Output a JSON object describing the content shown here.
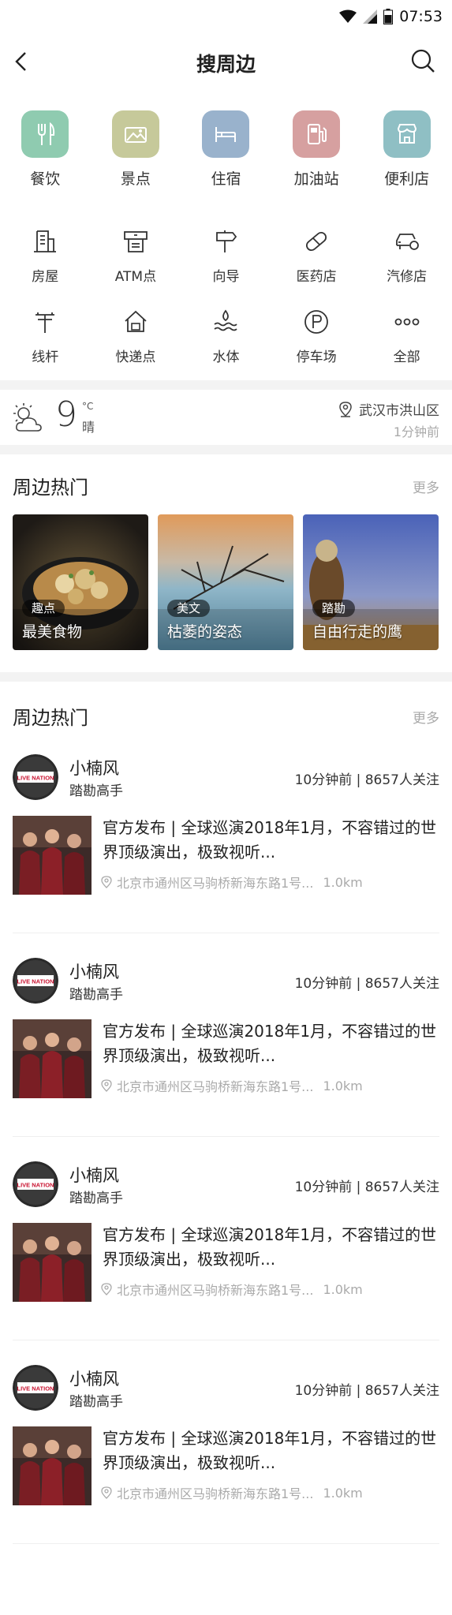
{
  "status": {
    "time": "07:53"
  },
  "nav": {
    "title": "搜周边"
  },
  "top_categories": [
    {
      "label": "餐饮",
      "icon": "utensils-icon",
      "color": "#8fcbb0"
    },
    {
      "label": "景点",
      "icon": "landscape-icon",
      "color": "#c6c99a"
    },
    {
      "label": "住宿",
      "icon": "bed-icon",
      "color": "#99b2cc"
    },
    {
      "label": "加油站",
      "icon": "fuel-pump-icon",
      "color": "#d6a0a0"
    },
    {
      "label": "便利店",
      "icon": "store-icon",
      "color": "#8fbfc4"
    }
  ],
  "grid_row1": [
    {
      "label": "房屋",
      "icon": "building-icon"
    },
    {
      "label": "ATM点",
      "icon": "atm-icon"
    },
    {
      "label": "向导",
      "icon": "signpost-icon"
    },
    {
      "label": "医药店",
      "icon": "pill-icon"
    },
    {
      "label": "汽修店",
      "icon": "car-repair-icon"
    }
  ],
  "grid_row2": [
    {
      "label": "线杆",
      "icon": "utility-pole-icon"
    },
    {
      "label": "快递点",
      "icon": "package-house-icon"
    },
    {
      "label": "水体",
      "icon": "water-icon"
    },
    {
      "label": "停车场",
      "icon": "parking-icon"
    },
    {
      "label": "全部",
      "icon": "more-dots-icon"
    }
  ],
  "weather": {
    "temp": "9",
    "unit": "°C",
    "condition": "晴",
    "location": "武汉市洪山区",
    "updated": "1分钟前"
  },
  "hot_section": {
    "title": "周边热门",
    "more": "更多",
    "cards": [
      {
        "tag": "趣点",
        "name": "最美食物"
      },
      {
        "tag": "美文",
        "name": "枯萎的姿态"
      },
      {
        "tag": "踏勘",
        "name": "自由行走的鹰"
      }
    ]
  },
  "feed_section": {
    "title": "周边热门",
    "more": "更多",
    "items": [
      {
        "user": "小楠风",
        "role": "踏勘高手",
        "meta": "10分钟前 | 8657人关注",
        "title": "官方发布 | 全球巡演2018年1月，不容错过的世界顶级演出，极致视听...",
        "address": "北京市通州区马驹桥新海东路1号...",
        "distance": "1.0km"
      },
      {
        "user": "小楠风",
        "role": "踏勘高手",
        "meta": "10分钟前 | 8657人关注",
        "title": "官方发布 | 全球巡演2018年1月，不容错过的世界顶级演出，极致视听...",
        "address": "北京市通州区马驹桥新海东路1号...",
        "distance": "1.0km"
      },
      {
        "user": "小楠风",
        "role": "踏勘高手",
        "meta": "10分钟前 | 8657人关注",
        "title": "官方发布 | 全球巡演2018年1月，不容错过的世界顶级演出，极致视听...",
        "address": "北京市通州区马驹桥新海东路1号...",
        "distance": "1.0km"
      },
      {
        "user": "小楠风",
        "role": "踏勘高手",
        "meta": "10分钟前 | 8657人关注",
        "title": "官方发布 | 全球巡演2018年1月，不容错过的世界顶级演出，极致视听...",
        "address": "北京市通州区马驹桥新海东路1号...",
        "distance": "1.0km"
      }
    ]
  },
  "avatar_logo_text": "LIVE NATION"
}
